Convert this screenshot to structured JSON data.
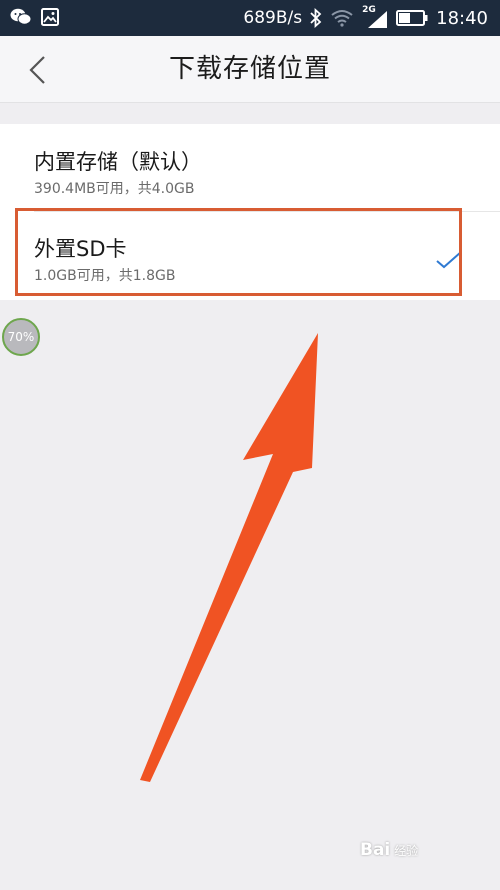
{
  "status_bar": {
    "speed": "689B/s",
    "network": "2G",
    "time": "18:40",
    "icons": [
      "wechat-icon",
      "image-icon",
      "bluetooth-icon",
      "wifi-icon",
      "signal-icon",
      "battery-icon"
    ]
  },
  "header": {
    "title": "下载存储位置",
    "back_icon": "chevron-left-icon"
  },
  "options": [
    {
      "title": "内置存储（默认）",
      "subtitle": "390.4MB可用，共4.0GB",
      "selected": false
    },
    {
      "title": "外置SD卡",
      "subtitle": "1.0GB可用，共1.8GB",
      "selected": true
    }
  ],
  "overlay": {
    "progress_badge": "70%",
    "highlight_color": "#d85c33",
    "arrow_color": "#f05323"
  },
  "watermark": {
    "brand": "Bai",
    "sub": "经验"
  },
  "colors": {
    "status_bar": "#1d2b3d",
    "check": "#2f7ad2"
  }
}
